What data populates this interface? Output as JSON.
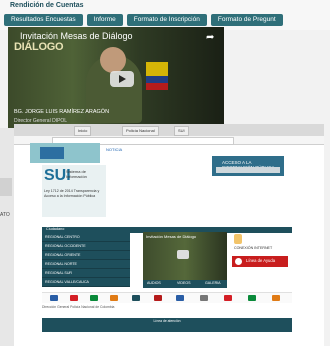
{
  "header": {
    "title": "Rendición de Cuentas",
    "tabs": [
      {
        "label": "Resultados Encuestas"
      },
      {
        "label": "Informe"
      },
      {
        "label": "Formato de Inscripción"
      },
      {
        "label": "Formato de Pregunt"
      }
    ]
  },
  "video": {
    "title": "Invitación Mesas de Diálogo",
    "subtitle": "DIÁLOGO",
    "caption1": "BG. JORGE LUIS RAMÍREZ ARAGÓN",
    "caption2": "Director General DIPOL"
  },
  "browser": {
    "tabs": [
      "Inicio",
      "Policía Nacional",
      "SUI"
    ],
    "link_text": "NOTICIA"
  },
  "sidebar": {
    "brand": "SUI",
    "subtitle": "Sistema de Información",
    "info": "Ley 1712 de 2014 Transparencia y Acceso a la Información Pública"
  },
  "ad_box": {
    "title": "ACCESO A LA INFORMACIÓN PÚBLICA"
  },
  "left_nav": {
    "header": "Ciudadano",
    "items": [
      "REGIONAL CENTRO",
      "REGIONAL OCCIDENTE",
      "REGIONAL ORIENTE",
      "REGIONAL NORTE",
      "REGIONAL SUR",
      "REGIONAL VALLE/CAUCA"
    ]
  },
  "mid_tabs": {
    "labels": [
      "AUDIOS",
      "VIDEOS",
      "GALERIA"
    ]
  },
  "right_col": {
    "text": "CONEXIÓN INTERNET",
    "button": "Línea de Ayuda"
  },
  "footer": {
    "line1": "Dirección General Policía Nacional de Colombia",
    "line2": "Línea de atención"
  },
  "side_text": "ATO"
}
